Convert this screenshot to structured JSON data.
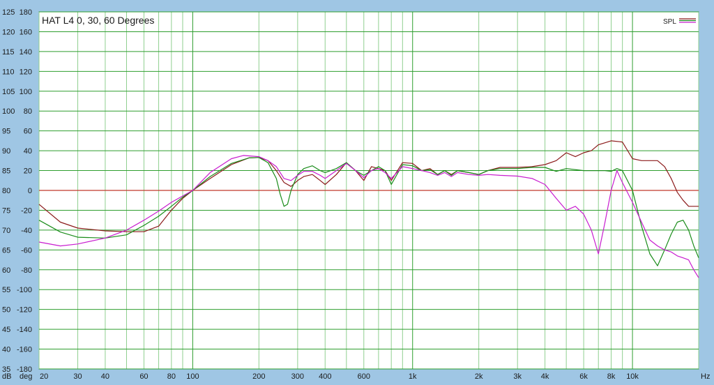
{
  "chart_data": {
    "type": "line",
    "title": "HAT L4 0, 30, 60 Degrees",
    "legend_label": "SPL",
    "legend_position": "top-right",
    "x_scale": "log",
    "xlim": [
      20,
      20000
    ],
    "ylim_db": [
      35,
      125
    ],
    "ylim_deg": [
      -180,
      180
    ],
    "db_unit": "dB",
    "deg_unit": "deg",
    "x_unit": "Hz",
    "db_ticks": [
      125,
      120,
      115,
      110,
      105,
      100,
      95,
      90,
      85,
      80,
      75,
      70,
      65,
      60,
      55,
      50,
      45,
      40,
      35
    ],
    "deg_ticks": [
      "180",
      "160",
      "140",
      "120",
      "100",
      "80",
      "60",
      "40",
      "20",
      "0",
      "-20",
      "-40",
      "-60",
      "-80",
      "-100",
      "-120",
      "-140",
      "-160",
      "-180"
    ],
    "x_ticks": [
      {
        "v": 20,
        "label": "20"
      },
      {
        "v": 30,
        "label": "30"
      },
      {
        "v": 40,
        "label": "40"
      },
      {
        "v": 60,
        "label": "60"
      },
      {
        "v": 80,
        "label": "80"
      },
      {
        "v": 100,
        "label": "100"
      },
      {
        "v": 200,
        "label": "200"
      },
      {
        "v": 300,
        "label": "300"
      },
      {
        "v": 400,
        "label": "400"
      },
      {
        "v": 600,
        "label": "600"
      },
      {
        "v": 1000,
        "label": "1k"
      },
      {
        "v": 2000,
        "label": "2k"
      },
      {
        "v": 3000,
        "label": "3k"
      },
      {
        "v": 4000,
        "label": "4k"
      },
      {
        "v": 6000,
        "label": "6k"
      },
      {
        "v": 8000,
        "label": "8k"
      },
      {
        "v": 10000,
        "label": "10k"
      }
    ],
    "grid": true,
    "colors": {
      "frame_bg": "#9fc6e4",
      "plot_bg": "#ffffff",
      "grid_major": "#2e9e2e",
      "grid_minor": "#8fcf8f",
      "hgrid": "#2e9e2e",
      "zero_line": "#c0392b"
    },
    "series": [
      {
        "name": "0",
        "color": "#8b1a1a",
        "points": [
          [
            20,
            76.5
          ],
          [
            25,
            72
          ],
          [
            30,
            70.5
          ],
          [
            40,
            69.8
          ],
          [
            50,
            69.6
          ],
          [
            60,
            69.6
          ],
          [
            70,
            71
          ],
          [
            80,
            75
          ],
          [
            90,
            78
          ],
          [
            100,
            80
          ],
          [
            120,
            83
          ],
          [
            150,
            86.5
          ],
          [
            180,
            88.2
          ],
          [
            200,
            88.3
          ],
          [
            220,
            87.5
          ],
          [
            240,
            85
          ],
          [
            260,
            82
          ],
          [
            280,
            81
          ],
          [
            300,
            82.5
          ],
          [
            320,
            83.5
          ],
          [
            350,
            84
          ],
          [
            380,
            82.5
          ],
          [
            400,
            81.5
          ],
          [
            450,
            84
          ],
          [
            500,
            87
          ],
          [
            550,
            85
          ],
          [
            600,
            82.5
          ],
          [
            650,
            86
          ],
          [
            700,
            85.5
          ],
          [
            750,
            85
          ],
          [
            800,
            82.5
          ],
          [
            900,
            87
          ],
          [
            1000,
            86.8
          ],
          [
            1100,
            85
          ],
          [
            1200,
            85.5
          ],
          [
            1300,
            84
          ],
          [
            1400,
            85
          ],
          [
            1500,
            84
          ],
          [
            1600,
            85
          ],
          [
            1800,
            84.5
          ],
          [
            2000,
            84
          ],
          [
            2200,
            85
          ],
          [
            2500,
            85.8
          ],
          [
            3000,
            85.8
          ],
          [
            3500,
            86
          ],
          [
            4000,
            86.5
          ],
          [
            4500,
            87.5
          ],
          [
            5000,
            89.5
          ],
          [
            5500,
            88.5
          ],
          [
            6000,
            89.5
          ],
          [
            6500,
            90
          ],
          [
            7000,
            91.5
          ],
          [
            7500,
            92
          ],
          [
            8000,
            92.5
          ],
          [
            9000,
            92.2
          ],
          [
            10000,
            88
          ],
          [
            11000,
            87.5
          ],
          [
            12000,
            87.5
          ],
          [
            13000,
            87.5
          ],
          [
            14000,
            86
          ],
          [
            15000,
            83
          ],
          [
            16000,
            79.5
          ],
          [
            17000,
            77.5
          ],
          [
            18000,
            76
          ],
          [
            20000,
            76
          ]
        ]
      },
      {
        "name": "30",
        "color": "#1a8c1a",
        "points": [
          [
            20,
            72.5
          ],
          [
            25,
            69.5
          ],
          [
            30,
            68.2
          ],
          [
            40,
            68
          ],
          [
            50,
            68.8
          ],
          [
            60,
            71.2
          ],
          [
            70,
            73.5
          ],
          [
            80,
            76
          ],
          [
            90,
            78.3
          ],
          [
            100,
            80
          ],
          [
            120,
            83.5
          ],
          [
            150,
            86.8
          ],
          [
            180,
            88.2
          ],
          [
            200,
            88.3
          ],
          [
            220,
            87
          ],
          [
            240,
            83
          ],
          [
            250,
            79
          ],
          [
            260,
            76
          ],
          [
            270,
            76.5
          ],
          [
            280,
            80
          ],
          [
            300,
            84
          ],
          [
            320,
            85.5
          ],
          [
            350,
            86.2
          ],
          [
            380,
            85
          ],
          [
            400,
            84.5
          ],
          [
            450,
            85.5
          ],
          [
            500,
            87
          ],
          [
            550,
            85
          ],
          [
            600,
            83.8
          ],
          [
            650,
            85
          ],
          [
            700,
            86
          ],
          [
            750,
            85
          ],
          [
            800,
            81.5
          ],
          [
            900,
            86.5
          ],
          [
            1000,
            86.2
          ],
          [
            1100,
            85
          ],
          [
            1200,
            85.2
          ],
          [
            1300,
            84
          ],
          [
            1400,
            85
          ],
          [
            1500,
            83.8
          ],
          [
            1600,
            85
          ],
          [
            1800,
            84.5
          ],
          [
            2000,
            84
          ],
          [
            2200,
            85
          ],
          [
            2500,
            85.5
          ],
          [
            3000,
            85.5
          ],
          [
            3500,
            85.8
          ],
          [
            4000,
            85.8
          ],
          [
            4500,
            84.8
          ],
          [
            5000,
            85.5
          ],
          [
            6000,
            85
          ],
          [
            7000,
            85
          ],
          [
            7500,
            85
          ],
          [
            8000,
            84.8
          ],
          [
            8500,
            85.5
          ],
          [
            9000,
            85
          ],
          [
            10000,
            80
          ],
          [
            11000,
            71
          ],
          [
            12000,
            64
          ],
          [
            13000,
            61
          ],
          [
            14000,
            65
          ],
          [
            15000,
            69
          ],
          [
            16000,
            72
          ],
          [
            17000,
            72.5
          ],
          [
            18000,
            70
          ],
          [
            19000,
            66
          ],
          [
            20000,
            63
          ]
        ]
      },
      {
        "name": "60",
        "color": "#c81ccf",
        "points": [
          [
            20,
            67
          ],
          [
            25,
            66
          ],
          [
            30,
            66.5
          ],
          [
            40,
            68
          ],
          [
            50,
            70
          ],
          [
            60,
            72.5
          ],
          [
            70,
            74.8
          ],
          [
            80,
            77
          ],
          [
            90,
            78.6
          ],
          [
            100,
            80
          ],
          [
            120,
            84.5
          ],
          [
            150,
            88
          ],
          [
            170,
            88.8
          ],
          [
            200,
            88.5
          ],
          [
            220,
            87.5
          ],
          [
            240,
            86
          ],
          [
            260,
            83
          ],
          [
            280,
            82.5
          ],
          [
            300,
            83.8
          ],
          [
            320,
            84.8
          ],
          [
            350,
            84.8
          ],
          [
            380,
            83.8
          ],
          [
            400,
            83
          ],
          [
            450,
            85
          ],
          [
            500,
            86.8
          ],
          [
            550,
            85
          ],
          [
            600,
            83.2
          ],
          [
            650,
            85
          ],
          [
            700,
            85.5
          ],
          [
            750,
            84.5
          ],
          [
            800,
            83
          ],
          [
            900,
            86
          ],
          [
            1000,
            85.5
          ],
          [
            1100,
            85
          ],
          [
            1200,
            84.5
          ],
          [
            1300,
            83.8
          ],
          [
            1400,
            84.5
          ],
          [
            1500,
            83.5
          ],
          [
            1600,
            84.5
          ],
          [
            1800,
            84
          ],
          [
            2000,
            83.8
          ],
          [
            2200,
            84
          ],
          [
            2500,
            83.8
          ],
          [
            3000,
            83.6
          ],
          [
            3500,
            83
          ],
          [
            4000,
            81.5
          ],
          [
            4500,
            78
          ],
          [
            5000,
            75
          ],
          [
            5500,
            76
          ],
          [
            6000,
            74
          ],
          [
            6500,
            70
          ],
          [
            7000,
            64
          ],
          [
            7500,
            72
          ],
          [
            8000,
            80
          ],
          [
            8500,
            85
          ],
          [
            9000,
            82
          ],
          [
            10000,
            77
          ],
          [
            11000,
            72
          ],
          [
            12000,
            67.5
          ],
          [
            13000,
            66
          ],
          [
            14000,
            65
          ],
          [
            15000,
            64.5
          ],
          [
            16000,
            63.5
          ],
          [
            17000,
            63
          ],
          [
            18000,
            62.5
          ],
          [
            19000,
            60
          ],
          [
            20000,
            58
          ]
        ]
      }
    ]
  }
}
